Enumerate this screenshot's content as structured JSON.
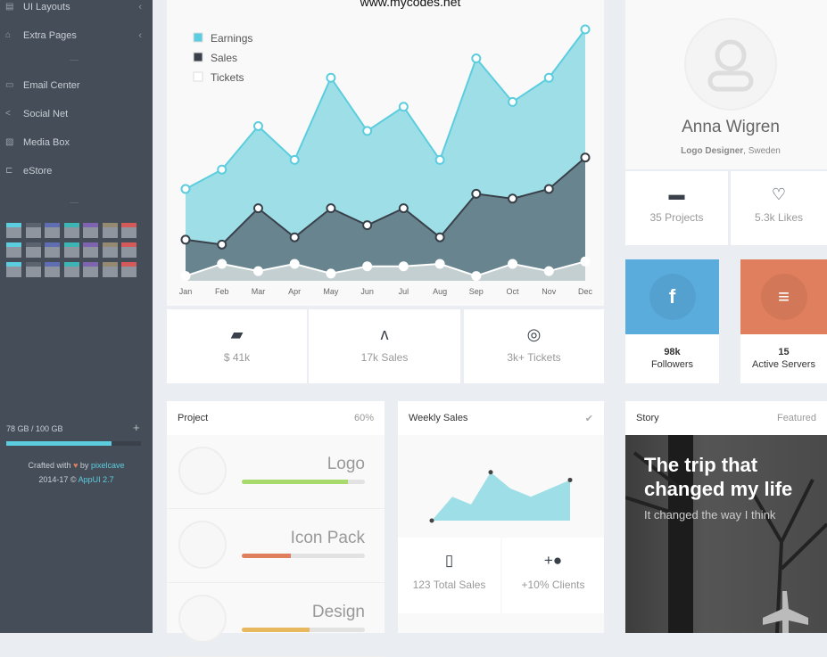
{
  "watermark": "www.mycodes.net",
  "sidebar": {
    "items": [
      {
        "label": "UI Layouts",
        "icon": "layers-icon",
        "submenu": true
      },
      {
        "label": "Extra Pages",
        "icon": "home-icon",
        "submenu": true
      },
      {
        "label": "Email Center",
        "icon": "inbox-icon"
      },
      {
        "label": "Social Net",
        "icon": "share-icon"
      },
      {
        "label": "Media Box",
        "icon": "image-icon"
      },
      {
        "label": "eStore",
        "icon": "cart-icon"
      }
    ],
    "theme_colors": [
      "#5ccdde",
      "#5a636e",
      "#5f6eb2",
      "#3eb5b5",
      "#7d63b0",
      "#948a72",
      "#d45a5a"
    ],
    "storage_label": "78 GB / 100 GB",
    "storage_percent": 78,
    "crafted_prefix": "Crafted with",
    "crafted_by": "by",
    "crafted_author": "pixelcave",
    "copyright": "2014-17 ©",
    "app_version": "AppUI 2.7"
  },
  "chart_data": {
    "type": "area",
    "categories": [
      "Jan",
      "Feb",
      "Mar",
      "Apr",
      "May",
      "Jun",
      "Jul",
      "Aug",
      "Sep",
      "Oct",
      "Nov",
      "Dec"
    ],
    "series": [
      {
        "name": "Earnings",
        "color": "#9edfe7",
        "line": "#5ccdde",
        "values": [
          38,
          46,
          64,
          50,
          84,
          62,
          72,
          50,
          92,
          74,
          84,
          104
        ]
      },
      {
        "name": "Sales",
        "color": "#68858f",
        "line": "#394049",
        "values": [
          17,
          15,
          30,
          18,
          30,
          23,
          30,
          18,
          36,
          34,
          38,
          51
        ]
      },
      {
        "name": "Tickets",
        "color": "#c4cfd1",
        "line": "#ffffff",
        "values": [
          2,
          7,
          4,
          7,
          3,
          6,
          6,
          7,
          2,
          7,
          4,
          8
        ]
      }
    ],
    "ylim": [
      0,
      110
    ],
    "grid": false,
    "legend": "top-left"
  },
  "stats": [
    {
      "icon": "wallet-icon",
      "label": "$ 41k"
    },
    {
      "icon": "pulse-icon",
      "label": "17k Sales"
    },
    {
      "icon": "lifebuoy-icon",
      "label": "3k+ Tickets"
    }
  ],
  "profile": {
    "name": "Anna Wigren",
    "role": "Logo Designer",
    "location": ", Sweden",
    "stats": [
      {
        "icon": "briefcase-icon",
        "label": "35 Projects"
      },
      {
        "icon": "heart-icon",
        "label": "5.3k Likes"
      }
    ]
  },
  "tiles": [
    {
      "icon": "facebook-icon",
      "value": "98k",
      "label": "Followers",
      "color": "#5aacdd"
    },
    {
      "icon": "database-icon",
      "value": "15",
      "label": "Active Servers",
      "color": "#e07f5e"
    }
  ],
  "project": {
    "title": "Project",
    "percent_label": "60%",
    "items": [
      {
        "name": "Logo",
        "progress": 86,
        "color": "#a8d96c"
      },
      {
        "name": "Icon Pack",
        "progress": 40,
        "color": "#e07f5e"
      },
      {
        "name": "Design",
        "progress": 55,
        "color": "#e8b85e"
      }
    ]
  },
  "weekly": {
    "title": "Weekly Sales",
    "values": [
      0,
      40,
      27,
      81,
      54,
      40,
      68
    ],
    "stats": [
      {
        "icon": "book-icon",
        "label": "123 Total Sales"
      },
      {
        "icon": "add-user-icon",
        "label": "+10% Clients"
      }
    ]
  },
  "story": {
    "title": "Story",
    "badge": "Featured",
    "headline": "The trip that changed my life",
    "subtitle": "It changed the way I think"
  }
}
